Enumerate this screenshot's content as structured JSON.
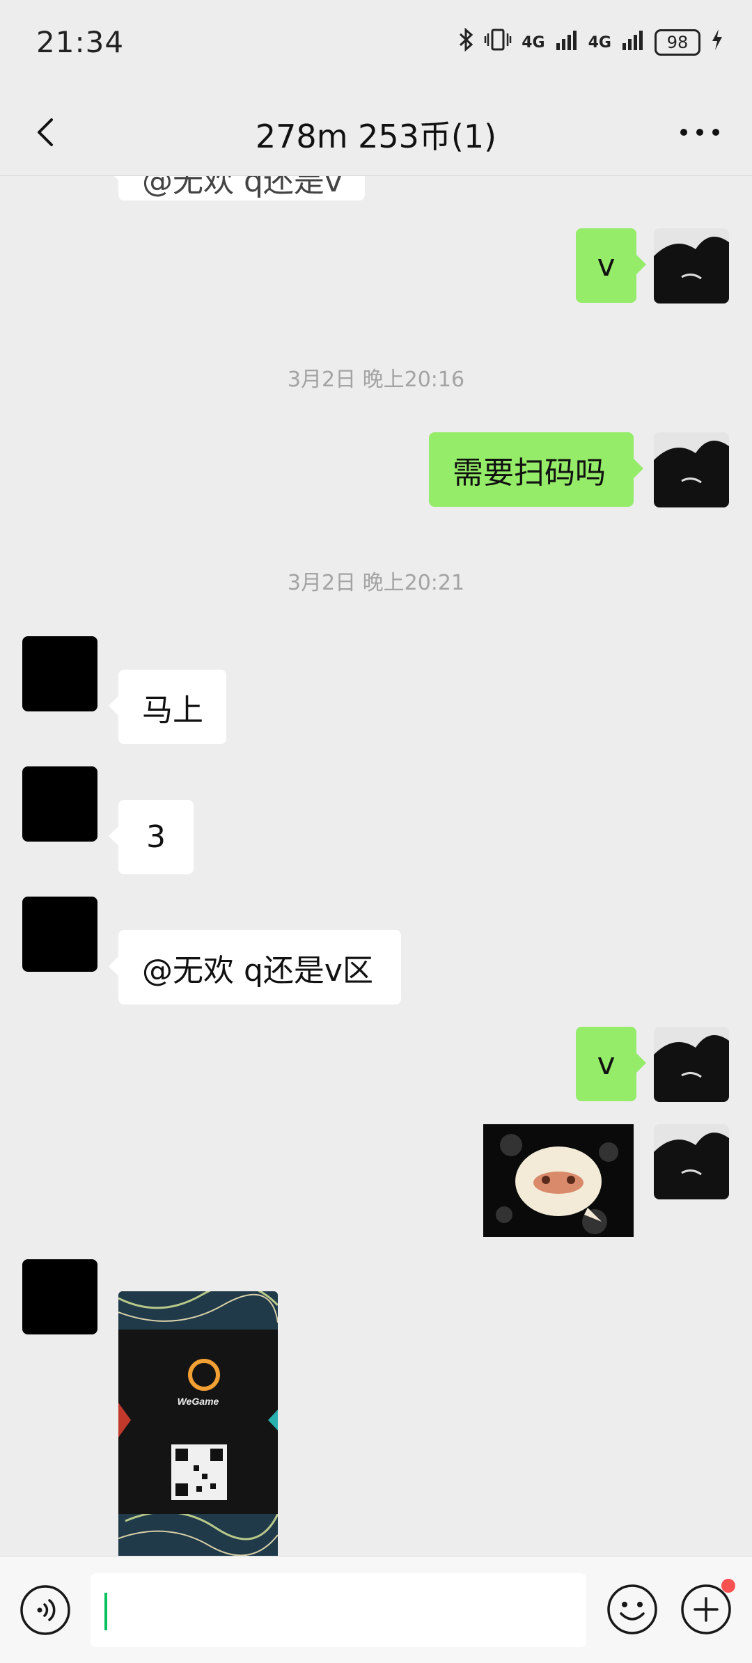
{
  "status": {
    "time": "21:34",
    "network1": "4G",
    "network2": "4G",
    "battery": "98"
  },
  "header": {
    "title": "278m 253币(1)"
  },
  "messages": {
    "partial_top": "@无欢 q还是v",
    "m1_text": "v",
    "time1": "3月2日 晚上20:16",
    "m2_text": "需要扫码吗",
    "time2": "3月2日 晚上20:21",
    "m3_text": "马上",
    "m4_text": "3",
    "m5_text": "@无欢 q还是v区",
    "m6_text": "v",
    "qr_brand": "WeGame"
  },
  "input": {
    "value": ""
  },
  "colors": {
    "bg": "#ededed",
    "self_bubble": "#95ec69",
    "other_bubble": "#ffffff",
    "accent": "#07c160",
    "badge": "#fa5151"
  }
}
